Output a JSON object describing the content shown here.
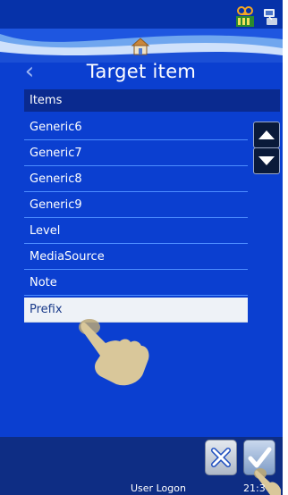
{
  "title": "Target item",
  "list": {
    "header": "Items",
    "items": [
      {
        "label": "Generic6",
        "selected": false
      },
      {
        "label": "Generic7",
        "selected": false
      },
      {
        "label": "Generic8",
        "selected": false
      },
      {
        "label": "Generic9",
        "selected": false
      },
      {
        "label": "Level",
        "selected": false
      },
      {
        "label": "MediaSource",
        "selected": false
      },
      {
        "label": "Note",
        "selected": false
      },
      {
        "label": "Prefix",
        "selected": true
      }
    ]
  },
  "footer": {
    "user_label": "User Logon",
    "time": "21:3"
  },
  "icons": {
    "back": "chevron-left-icon",
    "home": "home-icon",
    "scroll_up": "triangle-up-icon",
    "scroll_down": "triangle-down-icon",
    "cancel": "close-icon",
    "ok": "checkmark-icon",
    "pointer": "hand-pointer-icon"
  },
  "colors": {
    "background": "#0b3fd0",
    "header": "#0a2a8f",
    "selection": "#eef2f7",
    "divider": "#4d8dff",
    "hand": "#d9c79a",
    "footer_bar": "#0e2d84"
  }
}
